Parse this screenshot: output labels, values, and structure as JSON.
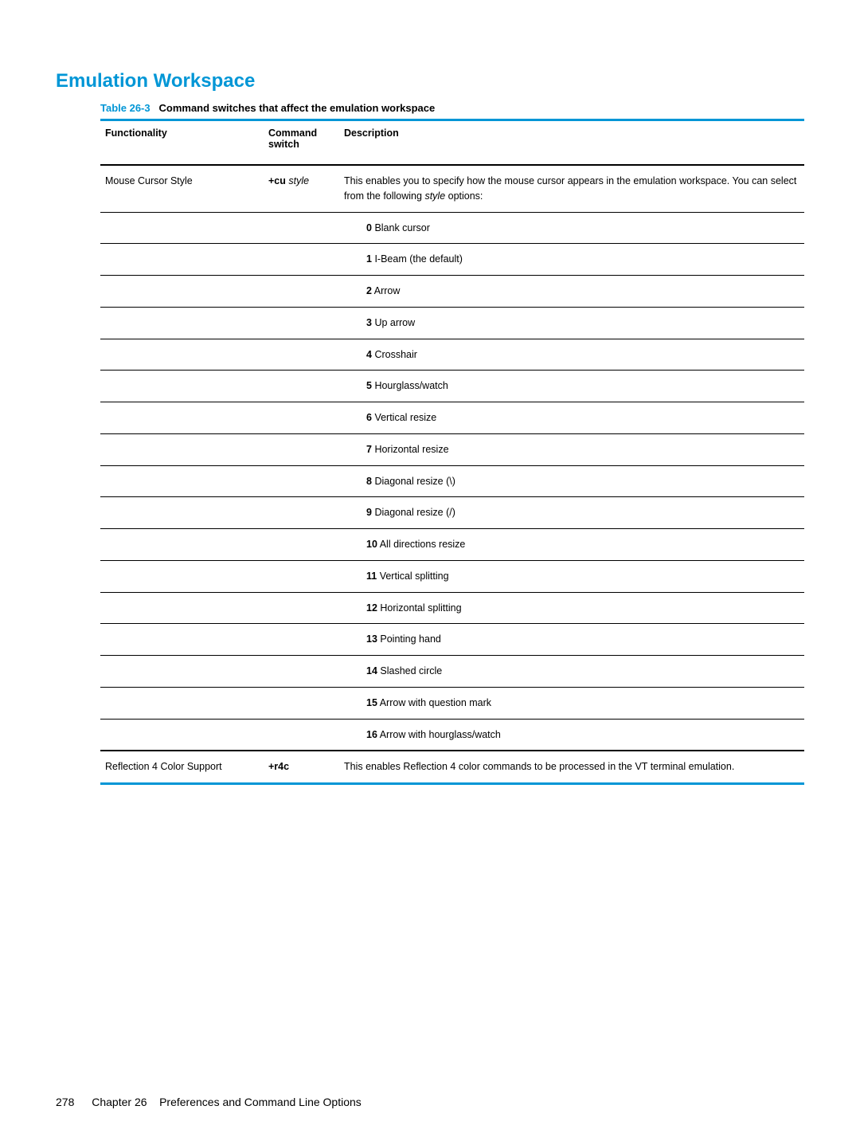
{
  "section_heading": "Emulation Workspace",
  "table": {
    "caption_prefix": "Table 26-3",
    "caption_title": "Command switches that affect the emulation workspace",
    "headers": {
      "functionality": "Functionality",
      "command_switch": "Command switch",
      "description": "Description"
    },
    "rows": [
      {
        "functionality": "Mouse Cursor Style",
        "switch_bold": "+cu",
        "switch_italic": "style",
        "desc_lead_before_italic": "This enables you to specify how the mouse cursor appears in the emulation workspace. You can select from the following ",
        "desc_italic": "style",
        "desc_lead_after_italic": " options:",
        "options": [
          {
            "num": "0",
            "label": "Blank cursor"
          },
          {
            "num": "1",
            "label": "I-Beam (the default)"
          },
          {
            "num": "2",
            "label": "Arrow"
          },
          {
            "num": "3",
            "label": "Up arrow"
          },
          {
            "num": "4",
            "label": "Crosshair"
          },
          {
            "num": "5",
            "label": "Hourglass/watch"
          },
          {
            "num": "6",
            "label": "Vertical resize"
          },
          {
            "num": "7",
            "label": "Horizontal resize"
          },
          {
            "num": "8",
            "label": "Diagonal resize (\\)"
          },
          {
            "num": "9",
            "label": "Diagonal resize (/)"
          },
          {
            "num": "10",
            "label": "All directions resize"
          },
          {
            "num": "11",
            "label": "Vertical splitting"
          },
          {
            "num": "12",
            "label": "Horizontal splitting"
          },
          {
            "num": "13",
            "label": "Pointing hand"
          },
          {
            "num": "14",
            "label": "Slashed circle"
          },
          {
            "num": "15",
            "label": "Arrow with question mark"
          },
          {
            "num": "16",
            "label": "Arrow with hourglass/watch"
          }
        ]
      },
      {
        "functionality": "Reflection 4 Color Support",
        "switch_bold": "+r4c",
        "switch_italic": "",
        "description": "This enables Reflection 4 color commands to be processed in the VT terminal emulation."
      }
    ]
  },
  "footer": {
    "page_number": "278",
    "chapter": "Chapter 26",
    "chapter_title": "Preferences and Command Line Options"
  }
}
